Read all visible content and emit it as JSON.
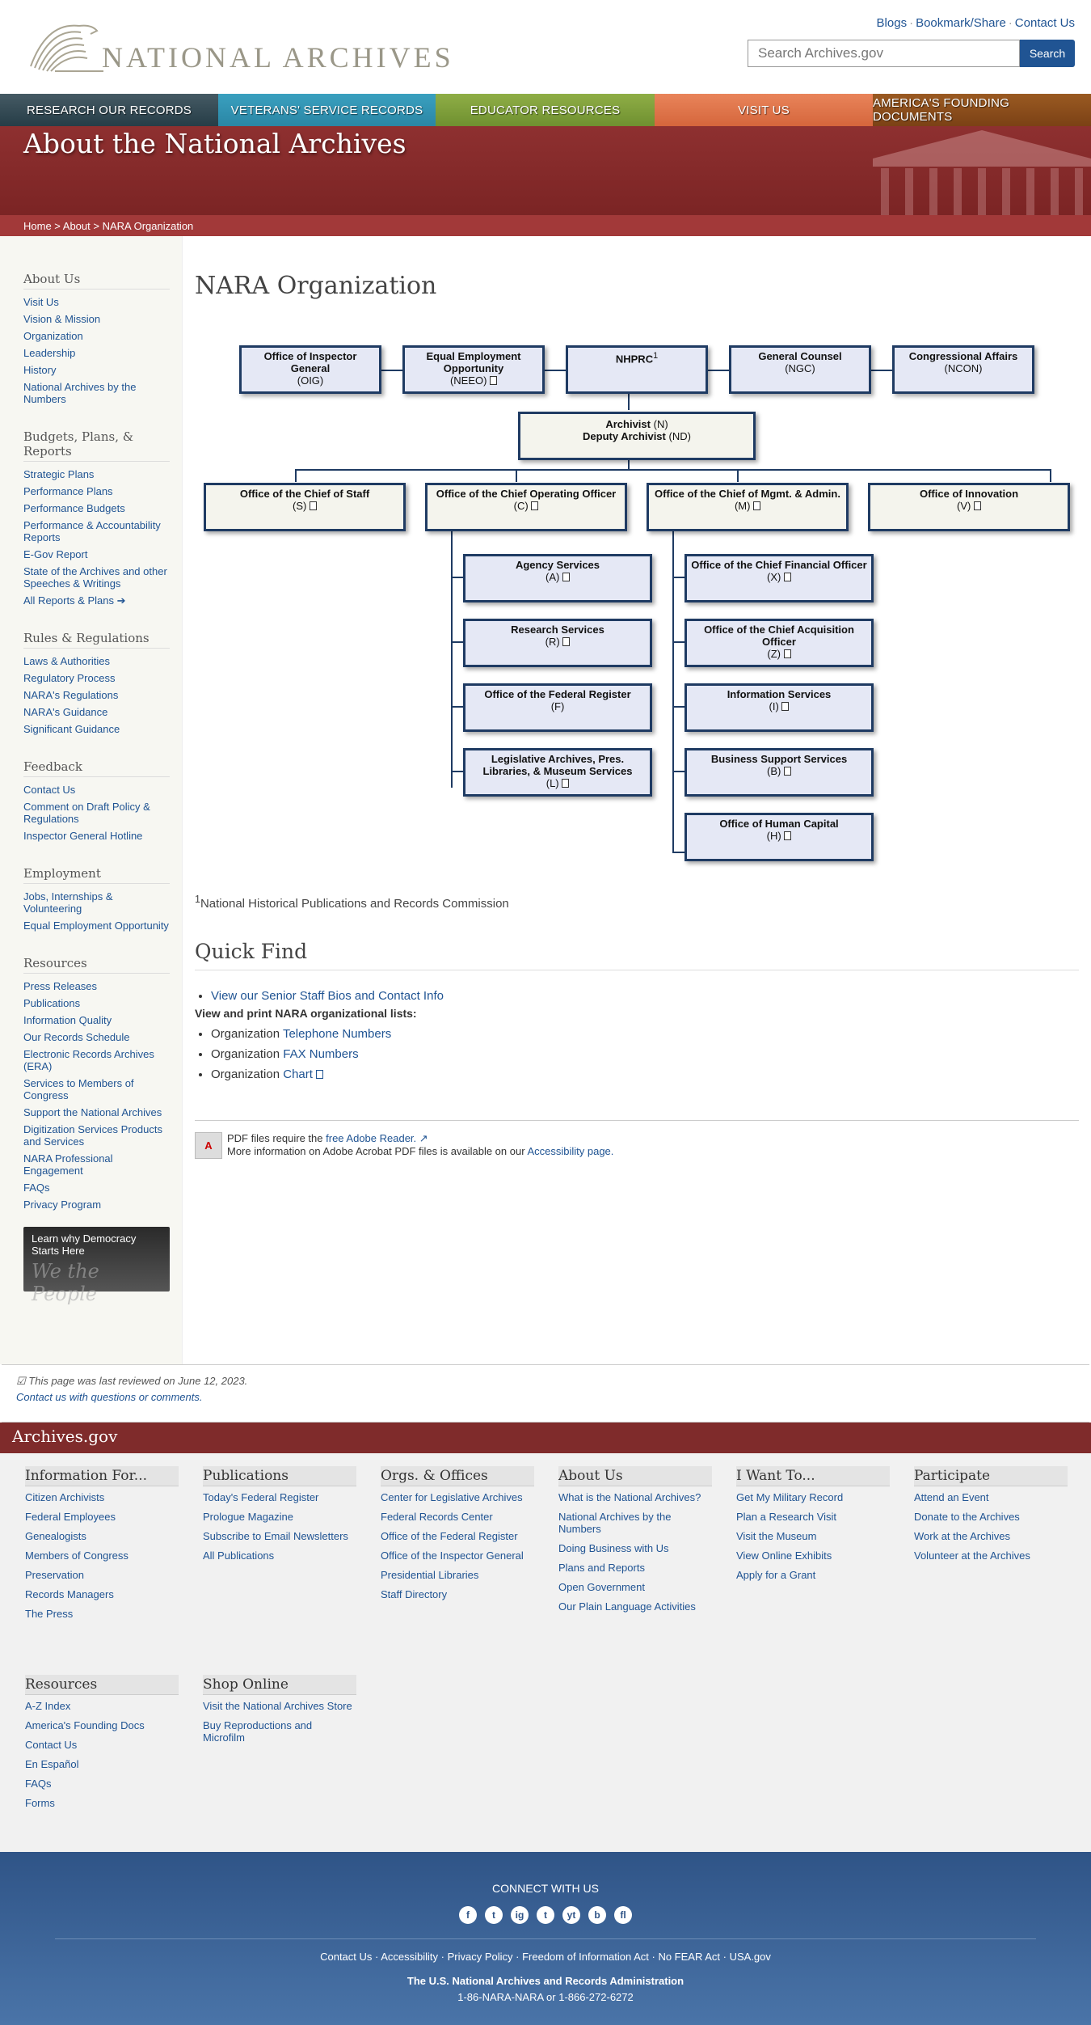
{
  "header": {
    "logo_text": "NATIONAL ARCHIVES",
    "util_links": [
      "Blogs",
      "Bookmark/Share",
      "Contact Us"
    ],
    "search_placeholder": "Search Archives.gov",
    "search_button": "Search"
  },
  "nav": [
    "RESEARCH OUR RECORDS",
    "VETERANS' SERVICE RECORDS",
    "EDUCATOR RESOURCES",
    "VISIT US",
    "AMERICA'S FOUNDING DOCUMENTS"
  ],
  "banner": {
    "title": "About the National Archives",
    "breadcrumb": "Home > About > NARA Organization"
  },
  "sidebar": [
    {
      "title": "About Us",
      "items": [
        "Visit Us",
        "Vision & Mission",
        "Organization",
        "Leadership",
        "History",
        "National Archives by the Numbers"
      ]
    },
    {
      "title": "Budgets, Plans, & Reports",
      "items": [
        "Strategic Plans",
        "Performance Plans",
        "Performance Budgets",
        "Performance & Accountability Reports",
        "E-Gov Report",
        "State of the Archives and other Speeches & Writings",
        "All Reports & Plans"
      ]
    },
    {
      "title": "Rules & Regulations",
      "items": [
        "Laws & Authorities",
        "Regulatory Process",
        "NARA's Regulations",
        "NARA's Guidance",
        "Significant Guidance"
      ]
    },
    {
      "title": "Feedback",
      "items": [
        "Contact Us",
        "Comment on Draft Policy & Regulations",
        "Inspector General Hotline"
      ]
    },
    {
      "title": "Employment",
      "items": [
        "Jobs, Internships & Volunteering",
        "Equal Employment Opportunity"
      ]
    },
    {
      "title": "Resources",
      "items": [
        "Press Releases",
        "Publications",
        "Information Quality",
        "Our Records Schedule",
        "Electronic Records Archives (ERA)",
        "Services to Members of Congress",
        "Support the National Archives",
        "Digitization Services Products and Services",
        "NARA Professional Engagement",
        "FAQs",
        "Privacy Program"
      ]
    }
  ],
  "promo": {
    "text": "Learn why Democracy Starts Here",
    "script": "We the People"
  },
  "page_title": "NARA Organization",
  "org": {
    "oig": {
      "title": "Office of Inspector General",
      "code": "(OIG)"
    },
    "neeo": {
      "title": "Equal Employment Opportunity",
      "code": "(NEEO)"
    },
    "nhprc": {
      "title": "NHPRC",
      "sup": "1"
    },
    "ngc": {
      "title": "General Counsel",
      "code": "(NGC)"
    },
    "ncon": {
      "title": "Congressional Affairs",
      "code": "(NCON)"
    },
    "archivist": {
      "title": "Archivist",
      "code": "(N)",
      "title2": "Deputy Archivist",
      "code2": "(ND)"
    },
    "staff": {
      "title": "Office of the Chief of Staff",
      "code": "(S)"
    },
    "coo": {
      "title": "Office of the Chief Operating Officer",
      "code": "(C)"
    },
    "mgmt": {
      "title": "Office of the Chief of Mgmt. & Admin.",
      "code": "(M)"
    },
    "innov": {
      "title": "Office of Innovation",
      "code": "(V)"
    },
    "agency": {
      "title": "Agency Services",
      "code": "(A)"
    },
    "research": {
      "title": "Research Services",
      "code": "(R)"
    },
    "fedreg": {
      "title": "Office of the Federal Register",
      "code": "(F)"
    },
    "leg": {
      "title": "Legislative Archives, Pres. Libraries, & Museum Services",
      "code": "(L)"
    },
    "cfo": {
      "title": "Office of the Chief Financial Officer",
      "code": "(X)"
    },
    "acq": {
      "title": "Office of the Chief Acquisition Officer",
      "code": "(Z)"
    },
    "info": {
      "title": "Information Services",
      "code": "(I)"
    },
    "bss": {
      "title": "Business Support Services",
      "code": "(B)"
    },
    "hc": {
      "title": "Office of Human Capital",
      "code": "(H)"
    }
  },
  "footnote": {
    "sup": "1",
    "text": "National Historical Publications and Records Commission"
  },
  "quick_find": {
    "title": "Quick Find",
    "bios_link": "View our Senior Staff Bios and Contact Info",
    "lists_heading": "View and print NARA organizational lists:",
    "prefix": "Organization",
    "links": [
      "Telephone Numbers",
      "FAX Numbers",
      "Chart"
    ]
  },
  "pdf_note": {
    "line1_prefix": "PDF files require the",
    "line1_link": "free Adobe Reader.",
    "line2_prefix": "More information on Adobe Acrobat PDF files is available on our",
    "line2_link": "Accessibility page."
  },
  "review": {
    "text": "This page was last reviewed on June 12, 2023.",
    "contact": "Contact us with questions or comments."
  },
  "footer": {
    "brand": "Archives.gov",
    "columns": [
      {
        "title": "Information For...",
        "items": [
          "Citizen Archivists",
          "Federal Employees",
          "Genealogists",
          "Members of Congress",
          "Preservation",
          "Records Managers",
          "The Press"
        ]
      },
      {
        "title": "Publications",
        "items": [
          "Today's Federal Register",
          "Prologue Magazine",
          "Subscribe to Email Newsletters",
          "All Publications"
        ]
      },
      {
        "title": "Orgs. & Offices",
        "items": [
          "Center for Legislative Archives",
          "Federal Records Center",
          "Office of the Federal Register",
          "Office of the Inspector General",
          "Presidential Libraries",
          "Staff Directory"
        ]
      },
      {
        "title": "About Us",
        "items": [
          "What is the National Archives?",
          "National Archives by the Numbers",
          "Doing Business with Us",
          "Plans and Reports",
          "Open Government",
          "Our Plain Language Activities"
        ]
      },
      {
        "title": "I Want To...",
        "items": [
          "Get My Military Record",
          "Plan a Research Visit",
          "Visit the Museum",
          "View Online Exhibits",
          "Apply for a Grant"
        ]
      },
      {
        "title": "Participate",
        "items": [
          "Attend an Event",
          "Donate to the Archives",
          "Work at the Archives",
          "Volunteer at the Archives"
        ]
      },
      {
        "title": "Resources",
        "items": [
          "A-Z Index",
          "America's Founding Docs",
          "Contact Us",
          "En Español",
          "FAQs",
          "Forms"
        ]
      },
      {
        "title": "Shop Online",
        "items": [
          "Visit the National Archives Store",
          "Buy Reproductions and Microfilm"
        ]
      }
    ],
    "connect_title": "CONNECT WITH US",
    "social": [
      "f",
      "t",
      "ig",
      "t",
      "yt",
      "b",
      "fl"
    ],
    "bottom_links": [
      "Contact Us",
      "Accessibility",
      "Privacy Policy",
      "Freedom of Information Act",
      "No FEAR Act",
      "USA.gov"
    ],
    "org_name": "The U.S. National Archives and Records Administration",
    "phone": "1-86-NARA-NARA or 1-866-272-6272"
  }
}
